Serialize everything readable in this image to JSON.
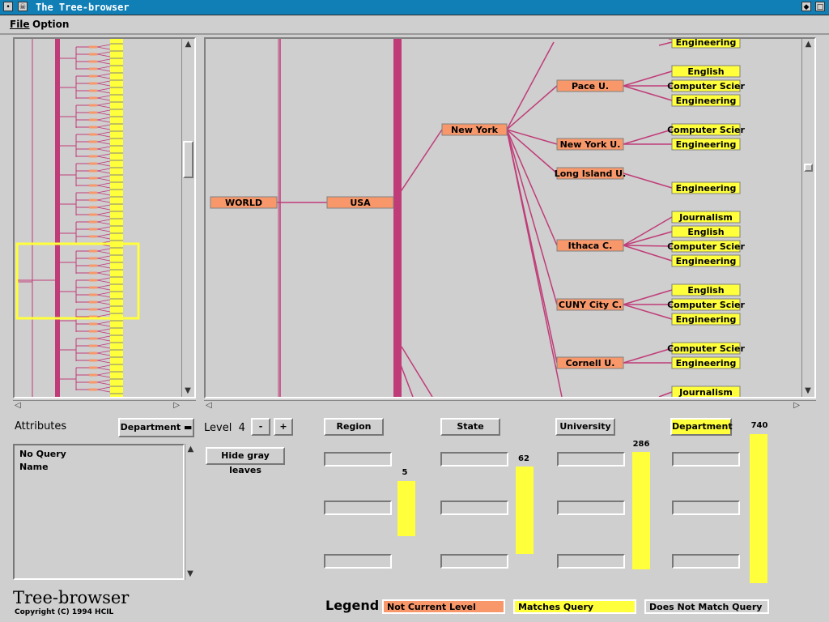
{
  "window": {
    "title": "The Tree-browser"
  },
  "menu": {
    "file": "File",
    "option": "Option"
  },
  "attributes": {
    "label": "Attributes",
    "dropdown_value": "Department",
    "list": [
      "No Query",
      "Name"
    ]
  },
  "level": {
    "label": "Level",
    "value": "4",
    "minus": "-",
    "plus": "+"
  },
  "hide_gray_leaves": "Hide gray leaves",
  "columns": [
    {
      "label": "Region",
      "count": "5",
      "count_value": 5,
      "highlighted": false
    },
    {
      "label": "State",
      "count": "62",
      "count_value": 62,
      "highlighted": false
    },
    {
      "label": "University",
      "count": "286",
      "count_value": 286,
      "highlighted": false
    },
    {
      "label": "Department",
      "count": "740",
      "count_value": 740,
      "highlighted": true
    }
  ],
  "tree": {
    "root": "WORLD",
    "country": "USA",
    "state": "New York",
    "universities": [
      "Pace U.",
      "New York U.",
      "Long Island U.",
      "Ithaca C.",
      "CUNY City C.",
      "Cornell U."
    ],
    "departments": {
      "top": "Engineering",
      "pace": [
        "English",
        "Computer Scier",
        "Engineering"
      ],
      "nyu": [
        "Computer Scier",
        "Engineering"
      ],
      "liu": [
        "Engineering"
      ],
      "ithaca": [
        "Journalism",
        "English",
        "Computer Scier",
        "Engineering"
      ],
      "cuny": [
        "English",
        "Computer Scier",
        "Engineering"
      ],
      "cornell": [
        "Computer Scier",
        "Engineering"
      ],
      "bottom": "Journalism"
    }
  },
  "branding": {
    "name": "Tree-browser",
    "copyright": "Copyright (C) 1994 HCIL"
  },
  "legend": {
    "title": "Legend",
    "not_current": "Not Current Level",
    "matches": "Matches Query",
    "no_match": "Does Not Match Query"
  },
  "colors": {
    "node": "#f8986a",
    "match": "#ffff3c",
    "edge": "#c03c78",
    "titlebar": "#0f7fb6",
    "overview_box": "#ffff3c"
  }
}
